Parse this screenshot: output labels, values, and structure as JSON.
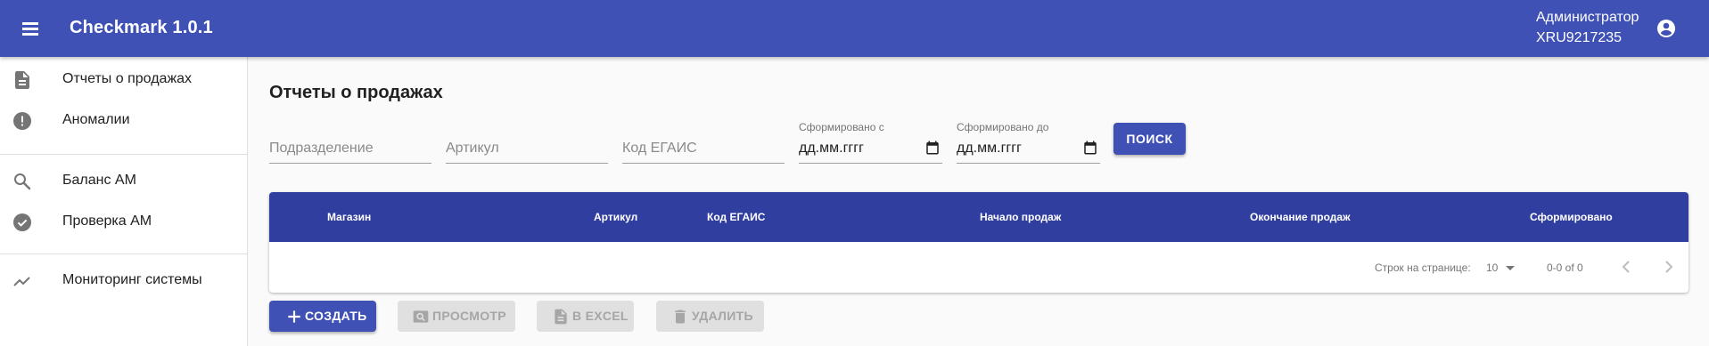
{
  "app": {
    "title": "Checkmark 1.0.1"
  },
  "header": {
    "user_role": "Администратор",
    "user_id": "XRU9217235"
  },
  "sidebar": {
    "items": [
      {
        "label": "Отчеты о продажах",
        "icon": "document-icon"
      },
      {
        "label": "Аномалии",
        "icon": "alert-circle-icon"
      },
      {
        "label": "Баланс АМ",
        "icon": "search-icon"
      },
      {
        "label": "Проверка АМ",
        "icon": "check-circle-icon"
      },
      {
        "label": "Мониторинг системы",
        "icon": "trending-up-icon"
      }
    ]
  },
  "page": {
    "title": "Отчеты о продажах"
  },
  "filters": {
    "subdivision_placeholder": "Подразделение",
    "article_placeholder": "Артикул",
    "egais_placeholder": "Код ЕГАИС",
    "date_from_label": "Сформировано с",
    "date_from_value": "дд.мм.гггг",
    "date_to_label": "Сформировано до",
    "date_to_value": "дд.мм.гггг",
    "search_label": "ПОИСК"
  },
  "table": {
    "columns": [
      "Магазин",
      "Артикул",
      "Код ЕГАИС",
      "Начало продаж",
      "Окончание продаж",
      "Сформировано"
    ],
    "rows": [],
    "rows_per_page_label": "Строк на странице:",
    "rows_per_page": "10",
    "range_text": "0-0 of 0"
  },
  "actions": {
    "create_label": "СОЗДАТЬ",
    "view_label": "ПРОСМОТР",
    "excel_label": "В EXCEL",
    "delete_label": "УДАЛИТЬ"
  },
  "colors": {
    "primary": "#3f51b5",
    "table_header": "#303f9f",
    "disabled_bg": "#e0e0e0",
    "disabled_text": "#a6a6a6"
  }
}
